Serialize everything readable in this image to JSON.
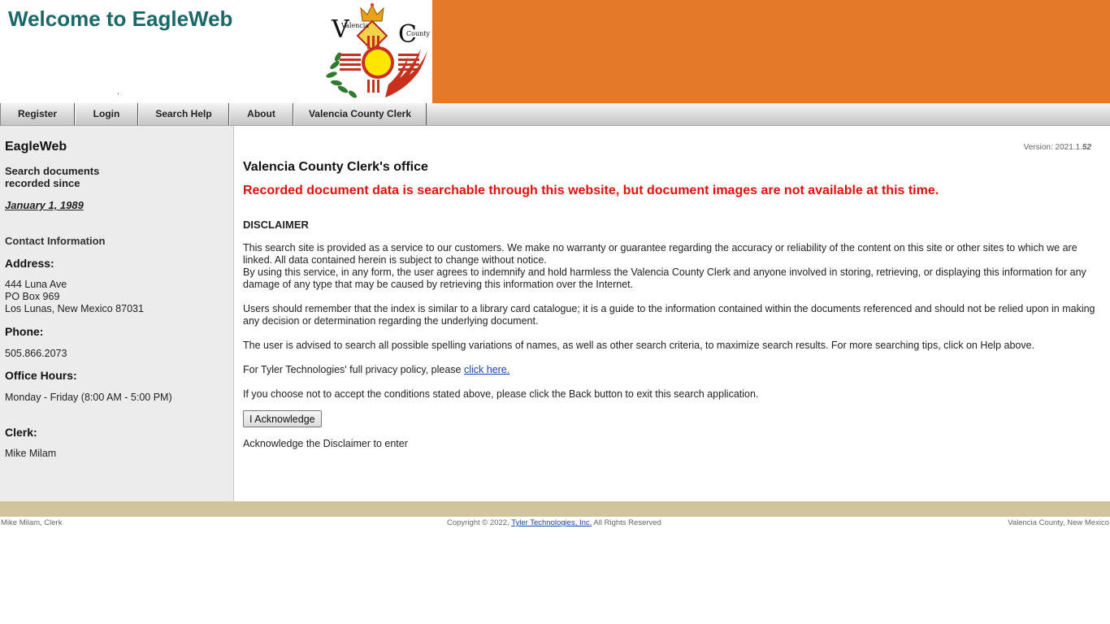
{
  "header": {
    "title": "Welcome to EagleWeb",
    "dot": ".",
    "logo_text_left": "Valencia",
    "logo_text_right": "County",
    "band_color": "#e5792a"
  },
  "nav": {
    "items": [
      {
        "label": "Register"
      },
      {
        "label": "Login"
      },
      {
        "label": "Search Help"
      },
      {
        "label": "About"
      },
      {
        "label": "Valencia County Clerk"
      }
    ]
  },
  "sidebar": {
    "title": "EagleWeb",
    "subtitle_line1": "Search documents",
    "subtitle_line2": "recorded since",
    "since_date": "January 1, 1989",
    "contact_heading": "Contact Information",
    "address_heading": "Address:",
    "address_line1": "444 Luna Ave",
    "address_line2": "PO Box 969",
    "address_line3": "Los Lunas, New Mexico 87031",
    "phone_heading": "Phone:",
    "phone": "505.866.2073",
    "hours_heading": "Office Hours:",
    "hours": "Monday - Friday (8:00 AM - 5:00 PM)",
    "clerk_heading": "Clerk:",
    "clerk": "Mike Milam"
  },
  "main": {
    "version_prefix": "Version: 2021.1.",
    "version_build": "52",
    "office_title": "Valencia County Clerk's office",
    "notice": "Recorded document data is searchable through this website, but document images are not available at this time.",
    "disclaimer_heading": "DISCLAIMER",
    "p1_a": "This search site is provided as a service to our customers. We make no warranty or guarantee regarding the accuracy or reliability of the content on this site or other sites to which we are linked. All data contained herein is subject to change without notice.",
    "p1_b": "By using this service, in any form, the user agrees to indemnify and hold harmless the Valencia County Clerk and anyone involved in storing, retrieving, or displaying this information for any damage of any type that may be caused by retrieving this information over the Internet.",
    "p2": "Users should remember that the index is similar to a library card catalogue; it is a guide to the information contained within the documents referenced and should not be relied upon in making any decision or determination regarding the underlying document.",
    "p3": "The user is advised to search all possible spelling variations of names, as well as other search criteria, to maximize search results. For more searching tips, click on Help above.",
    "p4_text": "For Tyler Technologies' full privacy policy, please ",
    "p4_link": "click here.",
    "p5": "If you choose not to accept the conditions stated above, please click the Back button to exit this search application.",
    "acknowledge_button": "I Acknowledge",
    "acknowledge_note": "Acknowledge the Disclaimer to enter"
  },
  "footer": {
    "left": "Mike Milam, Clerk",
    "copyright_prefix": "Copyright © 2022, ",
    "company_link": "Tyler Technologies, Inc.",
    "copyright_suffix": " All Rights Reserved",
    "right": "Valencia County, New Mexico",
    "bar_color": "#cfc49a"
  }
}
